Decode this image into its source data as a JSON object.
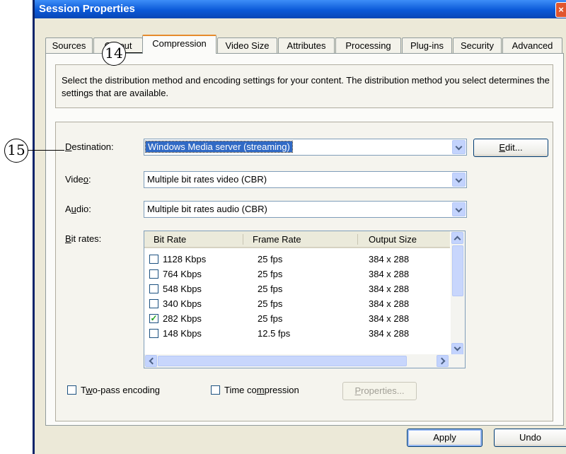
{
  "window": {
    "title": "Session Properties",
    "close_glyph": "×"
  },
  "tabs": [
    {
      "label": "Sources"
    },
    {
      "label": "Output"
    },
    {
      "label": "Compression"
    },
    {
      "label": "Video Size"
    },
    {
      "label": "Attributes"
    },
    {
      "label": "Processing"
    },
    {
      "label": "Plug-ins"
    },
    {
      "label": "Security"
    },
    {
      "label": "Advanced"
    }
  ],
  "info_text": "Select the distribution method and encoding settings for your content. The distribution method you select determines the settings that are available.",
  "form": {
    "destination": {
      "label_pre": "",
      "label_key": "D",
      "label_post": "estination:",
      "value": "Windows Media server (streaming)"
    },
    "video": {
      "label_pre": "Vide",
      "label_key": "o",
      "label_post": ":",
      "value": "Multiple bit rates video (CBR)"
    },
    "audio": {
      "label_pre": "A",
      "label_key": "u",
      "label_post": "dio:",
      "value": "Multiple bit rates audio (CBR)"
    },
    "bitrates_label": {
      "label_pre": "",
      "label_key": "B",
      "label_post": "it rates:"
    },
    "edit_button": {
      "pre": "",
      "key": "E",
      "post": "dit..."
    }
  },
  "bitrate_table": {
    "headers": [
      "Bit Rate",
      "Frame Rate",
      "Output Size"
    ],
    "rows": [
      {
        "bitrate": "1128 Kbps",
        "frame_rate": "25 fps",
        "size": "384 x 288",
        "checked": false
      },
      {
        "bitrate": "764 Kbps",
        "frame_rate": "25 fps",
        "size": "384 x 288",
        "checked": false
      },
      {
        "bitrate": "548 Kbps",
        "frame_rate": "25 fps",
        "size": "384 x 288",
        "checked": false
      },
      {
        "bitrate": "340 Kbps",
        "frame_rate": "25 fps",
        "size": "384 x 288",
        "checked": false
      },
      {
        "bitrate": "282 Kbps",
        "frame_rate": "25 fps",
        "size": "384 x 288",
        "checked": true
      },
      {
        "bitrate": "148 Kbps",
        "frame_rate": "12.5 fps",
        "size": "384 x 288",
        "checked": false
      }
    ],
    "check_glyph": "✓"
  },
  "options": {
    "two_pass": {
      "pre": "T",
      "key": "w",
      "post": "o-pass encoding",
      "checked": false
    },
    "time_compression": {
      "pre": "Time co",
      "key": "m",
      "post": "pression",
      "checked": false
    },
    "properties_button": {
      "pre": "",
      "key": "P",
      "post": "roperties...",
      "enabled": false
    }
  },
  "footer": {
    "apply": "Apply",
    "undo": "Undo"
  },
  "callouts": {
    "tab": "14",
    "destination": "15"
  }
}
